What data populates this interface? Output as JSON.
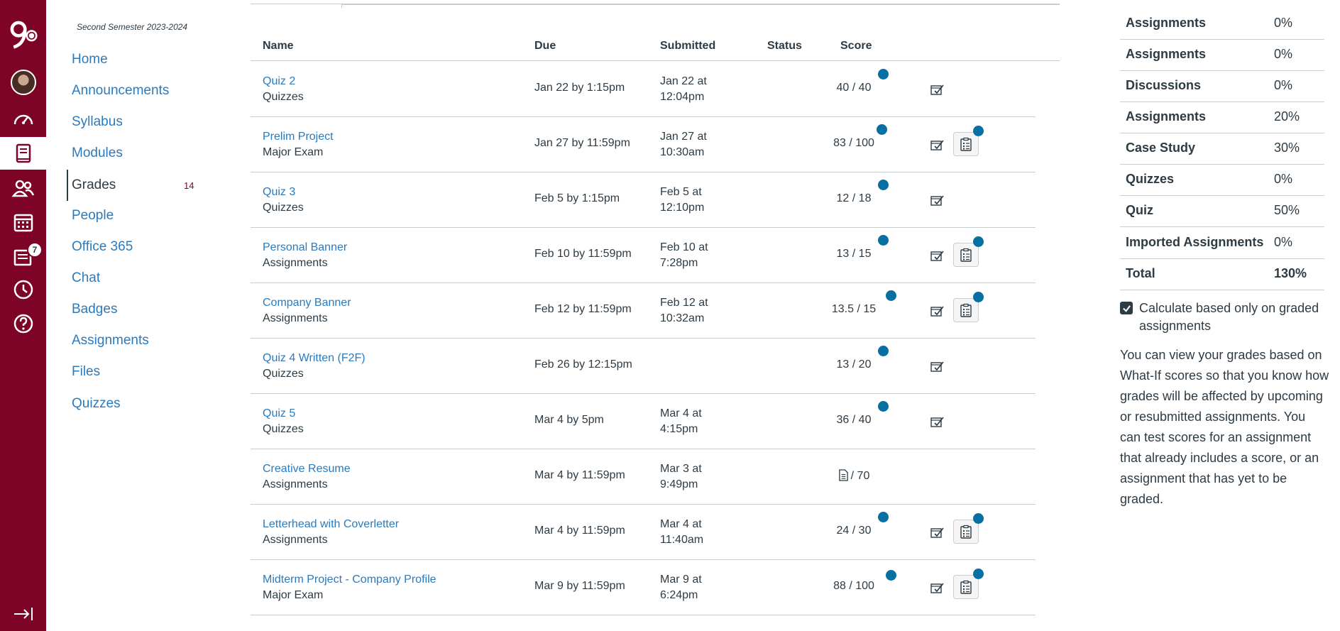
{
  "global_nav": {
    "inbox_badge": "7"
  },
  "course_nav": {
    "term": "Second Semester 2023-2024",
    "items": [
      {
        "label": "Home"
      },
      {
        "label": "Announcements"
      },
      {
        "label": "Syllabus"
      },
      {
        "label": "Modules"
      },
      {
        "label": "Grades",
        "count": "14"
      },
      {
        "label": "People"
      },
      {
        "label": "Office 365"
      },
      {
        "label": "Chat"
      },
      {
        "label": "Badges"
      },
      {
        "label": "Assignments"
      },
      {
        "label": "Files"
      },
      {
        "label": "Quizzes"
      }
    ]
  },
  "table": {
    "headers": {
      "name": "Name",
      "due": "Due",
      "submitted": "Submitted",
      "status": "Status",
      "score": "Score"
    },
    "rows": [
      {
        "name": "Quiz 2",
        "category": "Quizzes",
        "due": "Jan 22 by 1:15pm",
        "submitted_line1": "Jan 22 at",
        "submitted_line2": "12:04pm",
        "score": "40 / 40"
      },
      {
        "name": "Prelim Project",
        "category": "Major Exam",
        "due": "Jan 27 by 11:59pm",
        "submitted_line1": "Jan 27 at",
        "submitted_line2": "10:30am",
        "score": "83 / 100"
      },
      {
        "name": "Quiz 3",
        "category": "Quizzes",
        "due": "Feb 5 by 1:15pm",
        "submitted_line1": "Feb 5 at",
        "submitted_line2": "12:10pm",
        "score": "12 / 18"
      },
      {
        "name": "Personal Banner",
        "category": "Assignments",
        "due": "Feb 10 by 11:59pm",
        "submitted_line1": "Feb 10 at",
        "submitted_line2": "7:28pm",
        "score": "13 / 15"
      },
      {
        "name": "Company Banner",
        "category": "Assignments",
        "due": "Feb 12 by 11:59pm",
        "submitted_line1": "Feb 12 at",
        "submitted_line2": "10:32am",
        "score": "13.5 / 15"
      },
      {
        "name": "Quiz 4 Written (F2F)",
        "category": "Quizzes",
        "due": "Feb 26 by 12:15pm",
        "submitted_line1": "",
        "submitted_line2": "",
        "score": "13 / 20"
      },
      {
        "name": "Quiz 5",
        "category": "Quizzes",
        "due": "Mar 4 by 5pm",
        "submitted_line1": "Mar 4 at",
        "submitted_line2": "4:15pm",
        "score": "36 / 40"
      },
      {
        "name": "Creative Resume",
        "category": "Assignments",
        "due": "Mar 4 by 11:59pm",
        "submitted_line1": "Mar 3 at",
        "submitted_line2": "9:49pm",
        "score": "/ 70"
      },
      {
        "name": "Letterhead with Coverletter",
        "category": "Assignments",
        "due": "Mar 4 by 11:59pm",
        "submitted_line1": "Mar 4 at",
        "submitted_line2": "11:40am",
        "score": "24 / 30"
      },
      {
        "name": "Midterm Project - Company Profile",
        "category": "Major Exam",
        "due": "Mar 9 by 11:59pm",
        "submitted_line1": "Mar 9 at",
        "submitted_line2": "6:24pm",
        "score": "88 / 100"
      }
    ]
  },
  "weights": {
    "rows": [
      {
        "name": "Assignments",
        "pct": "0%"
      },
      {
        "name": "Assignments",
        "pct": "0%"
      },
      {
        "name": "Discussions",
        "pct": "0%"
      },
      {
        "name": "Assignments",
        "pct": "20%"
      },
      {
        "name": "Case Study",
        "pct": "30%"
      },
      {
        "name": "Quizzes",
        "pct": "0%"
      },
      {
        "name": "Quiz",
        "pct": "50%"
      },
      {
        "name": "Imported Assignments",
        "pct": "0%"
      },
      {
        "name": "Total",
        "pct": "130%"
      }
    ]
  },
  "calc_checkbox": {
    "label": "Calculate based only on graded assignments",
    "checked": true
  },
  "what_if_text": "You can view your grades based on What-If scores so that you know how grades will be affected by upcoming or resubmitted assignments. You can test scores for an assignment that already includes a score, or an assignment that has yet to be graded.",
  "colors": {
    "brand": "#7d0426",
    "link": "#2b7abc",
    "unread": "#0770a3"
  }
}
